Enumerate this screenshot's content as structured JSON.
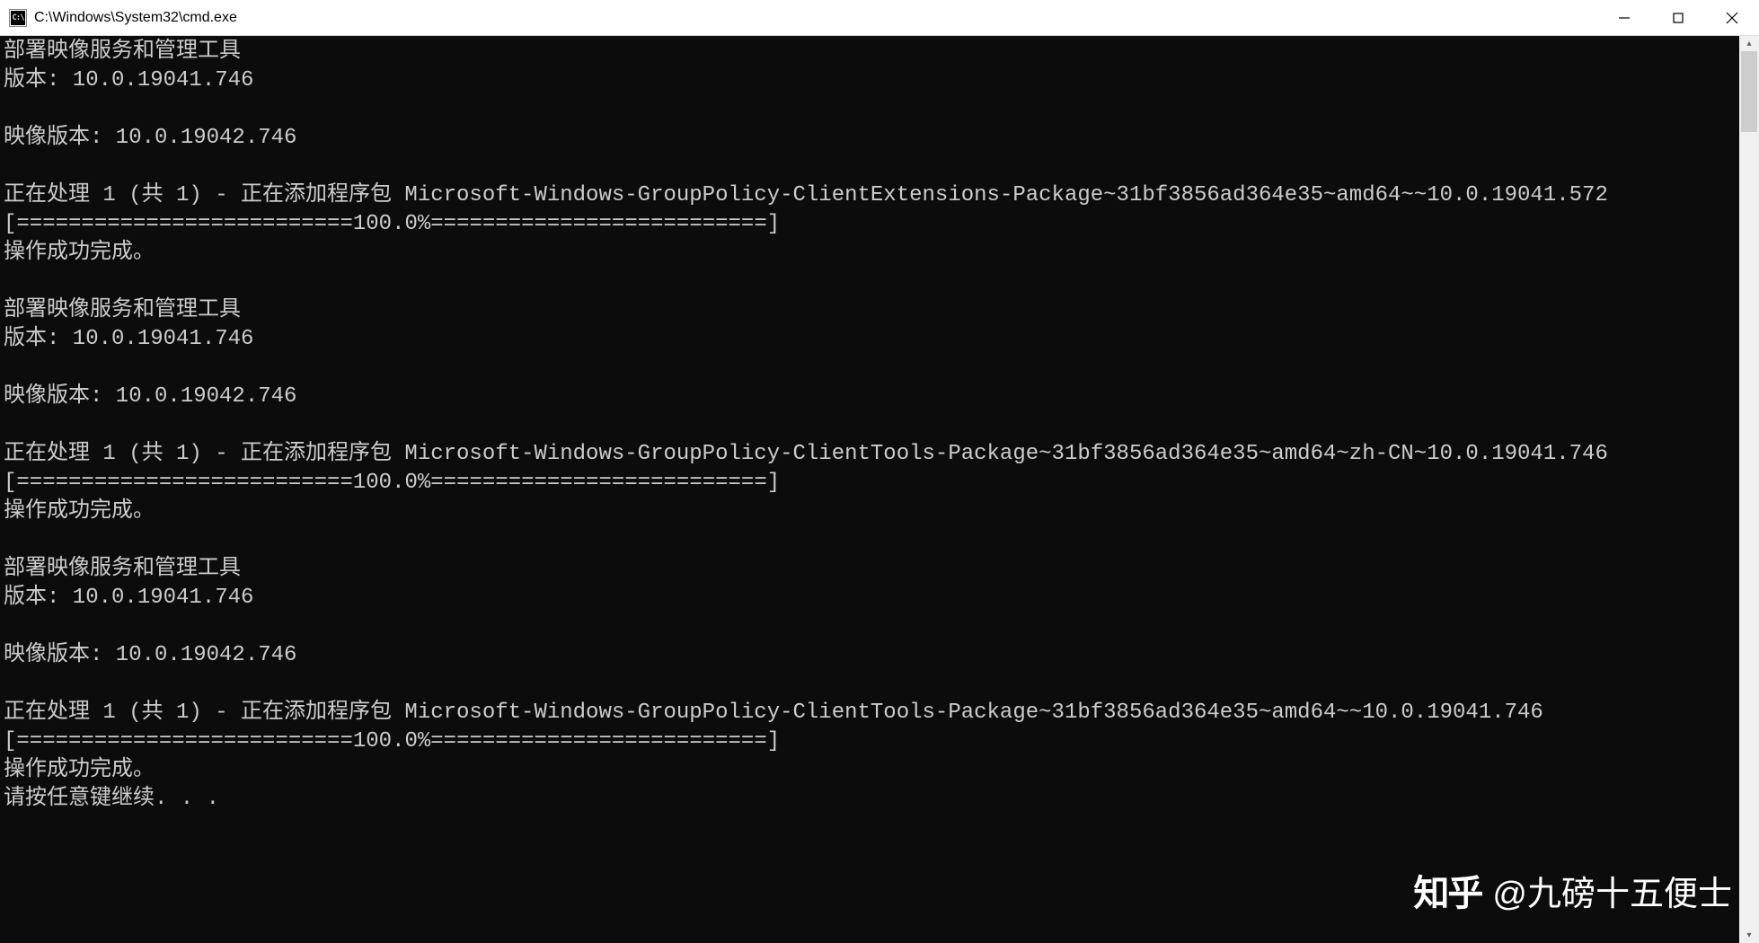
{
  "window": {
    "icon_text": "C:\\",
    "title": "C:\\Windows\\System32\\cmd.exe"
  },
  "terminal": {
    "lines": [
      "部署映像服务和管理工具",
      "版本: 10.0.19041.746",
      "",
      "映像版本: 10.0.19042.746",
      "",
      "正在处理 1 (共 1) - 正在添加程序包 Microsoft-Windows-GroupPolicy-ClientExtensions-Package~31bf3856ad364e35~amd64~~10.0.19041.572",
      "[==========================100.0%==========================]",
      "操作成功完成。",
      "",
      "部署映像服务和管理工具",
      "版本: 10.0.19041.746",
      "",
      "映像版本: 10.0.19042.746",
      "",
      "正在处理 1 (共 1) - 正在添加程序包 Microsoft-Windows-GroupPolicy-ClientTools-Package~31bf3856ad364e35~amd64~zh-CN~10.0.19041.746",
      "[==========================100.0%==========================]",
      "操作成功完成。",
      "",
      "部署映像服务和管理工具",
      "版本: 10.0.19041.746",
      "",
      "映像版本: 10.0.19042.746",
      "",
      "正在处理 1 (共 1) - 正在添加程序包 Microsoft-Windows-GroupPolicy-ClientTools-Package~31bf3856ad364e35~amd64~~10.0.19041.746",
      "[==========================100.0%==========================]",
      "操作成功完成。",
      "请按任意键继续. . ."
    ]
  },
  "watermark": {
    "logo": "知乎",
    "handle": "@九磅十五便士"
  }
}
